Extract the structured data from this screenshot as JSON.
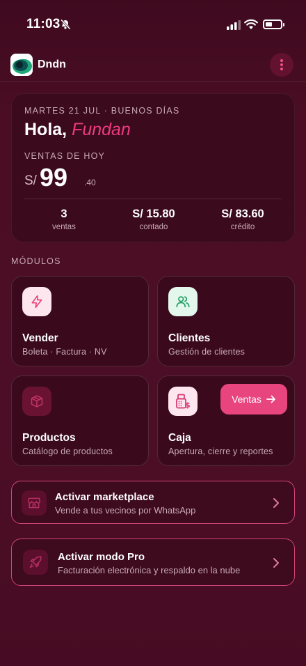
{
  "status_bar": {
    "time": "11:03"
  },
  "app": {
    "name": "Dndn"
  },
  "summary": {
    "date_line": "MARTES 21 JUL · BUENOS DÍAS",
    "greeting_prefix": "Hola,",
    "user_name": "Fundan",
    "sales_label": "VENTAS DE HOY",
    "currency": "S/",
    "amount_integer": "99",
    "amount_decimal": ".40",
    "stats": [
      {
        "value": "3",
        "label": "ventas"
      },
      {
        "value": "S/ 15.80",
        "label": "contado"
      },
      {
        "value": "S/ 83.60",
        "label": "crédito"
      }
    ]
  },
  "modules": {
    "section_title": "MÓDULOS",
    "items": [
      {
        "title": "Vender",
        "subtitle": "Boleta · Factura · NV",
        "icon": "lightning-icon"
      },
      {
        "title": "Clientes",
        "subtitle": "Gestión de clientes",
        "icon": "users-icon"
      },
      {
        "title": "Productos",
        "subtitle": "Catálogo de productos",
        "icon": "box-icon"
      },
      {
        "title": "Caja",
        "subtitle": "Apertura, cierre y reportes",
        "icon": "cash-register-icon",
        "button_label": "Ventas"
      }
    ]
  },
  "activations": [
    {
      "title": "Activar marketplace",
      "subtitle": "Vende a tus vecinos por WhatsApp",
      "icon": "store-icon"
    },
    {
      "title": "Activar modo Pro",
      "subtitle": "Facturación electrónica y respaldo en la nube",
      "icon": "rocket-icon"
    }
  ],
  "colors": {
    "background": "#4a0d24",
    "card": "#3a0a1c",
    "accent": "#e8457f",
    "accent_text": "#ee3b7f",
    "green": "#1f9d63",
    "muted_text": "#c9aab6"
  }
}
